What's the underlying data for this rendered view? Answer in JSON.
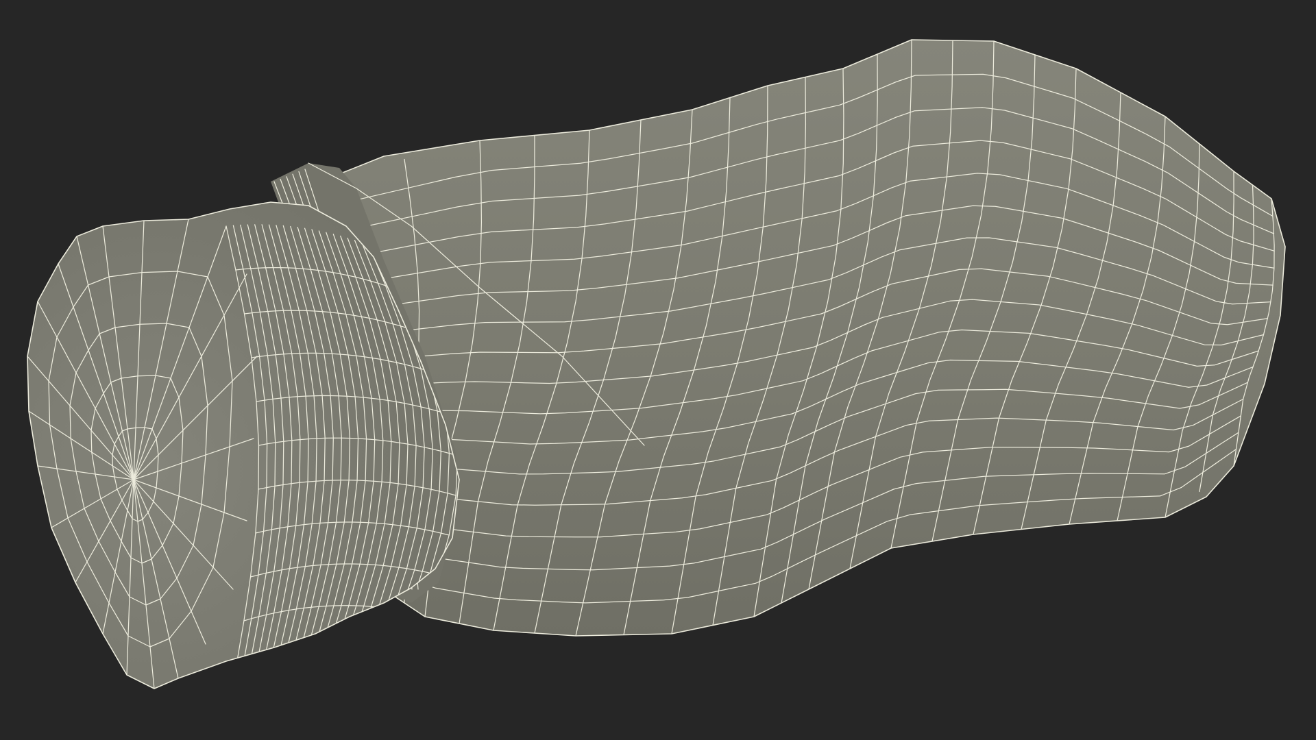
{
  "scene": {
    "background_color": "#262626",
    "mesh_fill_color": "#7b7b70",
    "mesh_shadow_color": "#6a6a60",
    "mesh_highlight_color": "#85857a",
    "wire_color": "#ecebdc",
    "view_mode": "wireframe-on-shaded",
    "object": "3d-mesh-model"
  }
}
